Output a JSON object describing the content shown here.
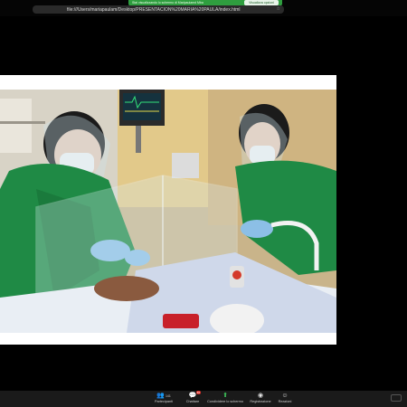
{
  "banner": {
    "text": "Stai visualizzando lo schermo di Maripaulamd Mba",
    "stop_label": "Visualizza opzioni"
  },
  "address": {
    "url": "file:///Users/mariapaulam/Desktop/PRESENTACION%20MARIA%20PAULA/index.html"
  },
  "toolbar": {
    "participants_label": "Partecipanti",
    "participants_count": "141",
    "chat_label": "Chattare",
    "chat_badge": "46",
    "share_label": "Condividere lo schermo",
    "record_label": "Registrazione",
    "reactions_label": "Reazioni"
  },
  "icons": {
    "participants": "people-icon",
    "chat": "chat-bubble-icon",
    "share": "share-screen-icon",
    "record": "record-icon",
    "reactions": "smiley-plus-icon"
  },
  "colors": {
    "share_green": "#2f9e3f",
    "gown_green": "#1f8a45",
    "background": "#000000"
  }
}
